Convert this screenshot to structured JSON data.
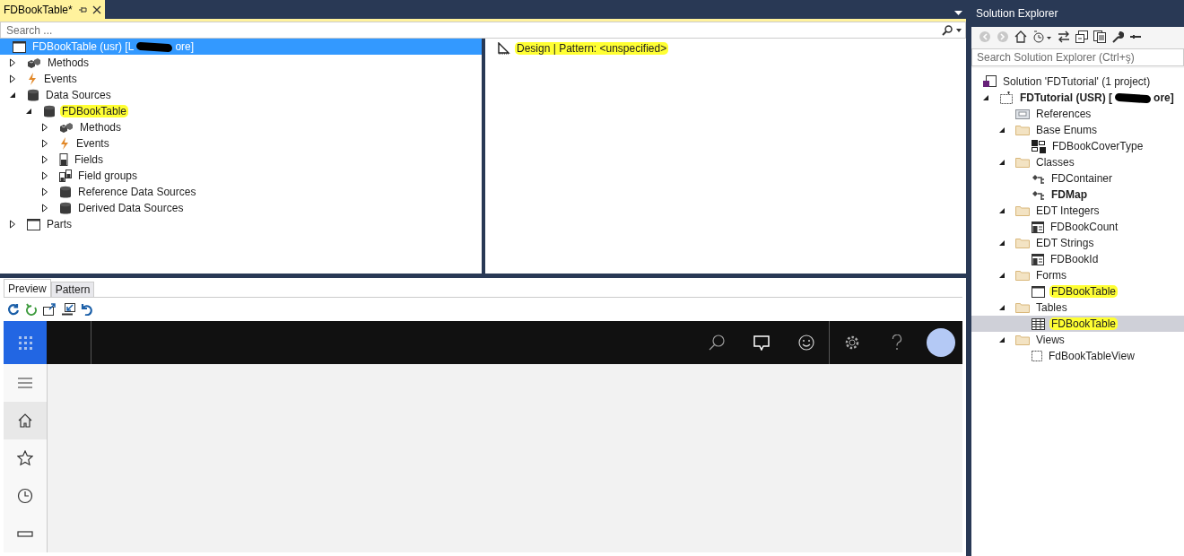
{
  "document_tab": {
    "title": "FDBookTable*"
  },
  "designer": {
    "search": {
      "placeholder": "Search ..."
    },
    "tree": {
      "root": {
        "label": "FDBookTable (usr) [L",
        "label_end": "ore]",
        "kind": "form",
        "selected": true
      },
      "items": [
        {
          "label": "Methods",
          "kind": "methods",
          "expanded": false
        },
        {
          "label": "Events",
          "kind": "events",
          "expanded": false
        },
        {
          "label": "Data Sources",
          "kind": "datasource",
          "expanded": true,
          "children": [
            {
              "label": "FDBookTable",
              "kind": "datasource",
              "expanded": true,
              "highlighted": true,
              "children": [
                {
                  "label": "Methods",
                  "kind": "methods",
                  "expanded": false
                },
                {
                  "label": "Events",
                  "kind": "events",
                  "expanded": false
                },
                {
                  "label": "Fields",
                  "kind": "fields",
                  "expanded": false
                },
                {
                  "label": "Field groups",
                  "kind": "fieldgroups",
                  "expanded": false
                },
                {
                  "label": "Reference Data Sources",
                  "kind": "datasource",
                  "expanded": false
                },
                {
                  "label": "Derived Data Sources",
                  "kind": "datasource",
                  "expanded": false
                }
              ]
            }
          ]
        },
        {
          "label": "Parts",
          "kind": "form",
          "expanded": false
        }
      ]
    },
    "pattern_pane": {
      "label": "Design | Pattern: <unspecified>",
      "highlighted": true
    }
  },
  "bottom_tabs": [
    {
      "label": "Preview",
      "selected": true
    },
    {
      "label": "Pattern",
      "selected": false
    }
  ],
  "preview": {
    "nav": [
      {
        "kind": "menu",
        "selected": false
      },
      {
        "kind": "home",
        "selected": true
      },
      {
        "kind": "favorites",
        "selected": false
      },
      {
        "kind": "recent",
        "selected": false
      },
      {
        "kind": "workspaces",
        "selected": false
      }
    ]
  },
  "solution_explorer": {
    "title": "Solution Explorer",
    "search": {
      "placeholder": "Search Solution Explorer (Ctrl+ş)"
    },
    "solution": {
      "label": "Solution 'FDTutorial' (1 project)"
    },
    "items": [
      {
        "label": "FDTutorial (USR) [",
        "label_end": "ore]",
        "kind": "project",
        "bold": true,
        "expanded": true,
        "children": [
          {
            "label": "References",
            "kind": "references"
          },
          {
            "label": "Base Enums",
            "kind": "folder",
            "expanded": true,
            "children": [
              {
                "label": "FDBookCoverType",
                "kind": "enum"
              }
            ]
          },
          {
            "label": "Classes",
            "kind": "folder",
            "expanded": true,
            "children": [
              {
                "label": "FDContainer",
                "kind": "class"
              },
              {
                "label": "FDMap",
                "kind": "class",
                "bold": true
              }
            ]
          },
          {
            "label": "EDT Integers",
            "kind": "folder",
            "expanded": true,
            "children": [
              {
                "label": "FDBookCount",
                "kind": "edt"
              }
            ]
          },
          {
            "label": "EDT Strings",
            "kind": "folder",
            "expanded": true,
            "children": [
              {
                "label": "FDBookId",
                "kind": "edt"
              }
            ]
          },
          {
            "label": "Forms",
            "kind": "folder",
            "expanded": true,
            "children": [
              {
                "label": "FDBookTable",
                "kind": "form",
                "highlighted": true
              }
            ]
          },
          {
            "label": "Tables",
            "kind": "folder",
            "expanded": true,
            "children": [
              {
                "label": "FDBookTable",
                "kind": "table",
                "highlighted": true,
                "selected": true
              }
            ]
          },
          {
            "label": "Views",
            "kind": "folder",
            "expanded": true,
            "children": [
              {
                "label": "FdBookTableView",
                "kind": "view"
              }
            ]
          }
        ]
      }
    ]
  }
}
